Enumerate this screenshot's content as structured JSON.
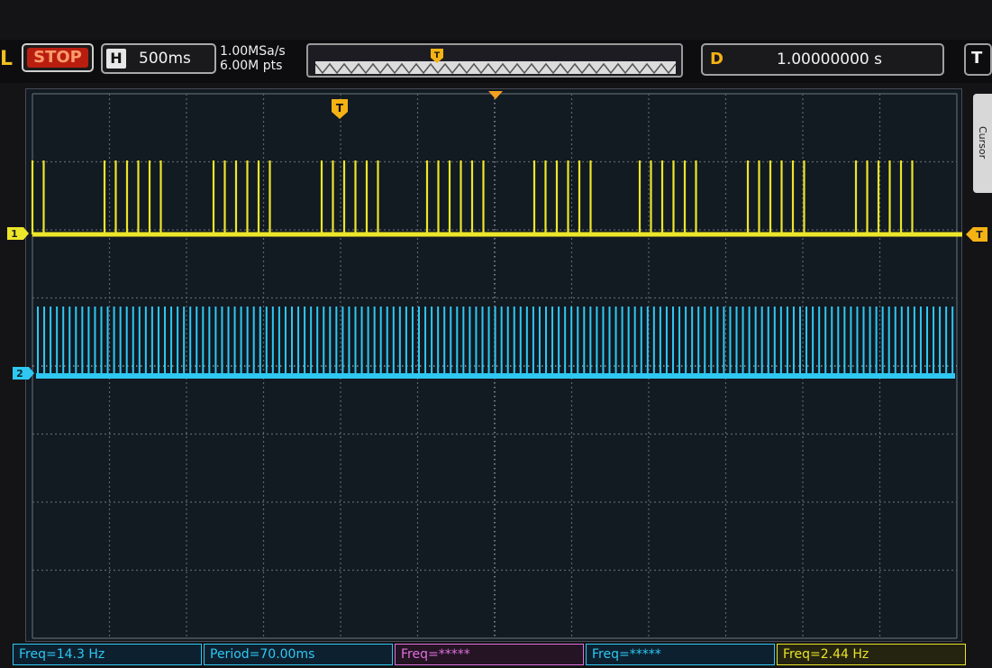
{
  "toolbar": {
    "mode_label": "L",
    "run_state_label": "STOP",
    "horizontal": {
      "label": "H",
      "timebase": "500ms"
    },
    "sample_rate": "1.00MSa/s",
    "memory_depth": "6.00M pts",
    "delay": {
      "label": "D",
      "value": "1.00000000 s"
    },
    "trigger_menu_label": "T"
  },
  "markers": {
    "trigger_marker": "T",
    "channel1_marker": "1",
    "channel2_marker": "2"
  },
  "side_menu": {
    "label": "Cursor"
  },
  "measurements": [
    {
      "text": "Freq=14.3 Hz"
    },
    {
      "text": "Period=70.00ms"
    },
    {
      "text": "Freq=*****"
    },
    {
      "text": "Freq=*****"
    },
    {
      "text": "Freq=2.44 Hz"
    }
  ],
  "colors": {
    "channel1": "#ece62a",
    "channel2": "#2ec8f2",
    "trigger": "#f5b214",
    "stop": "#b81e10"
  },
  "icons": [
    "trigger-position-marker",
    "channel-1-ground-marker",
    "channel-2-ground-marker",
    "trigger-level-marker"
  ]
}
